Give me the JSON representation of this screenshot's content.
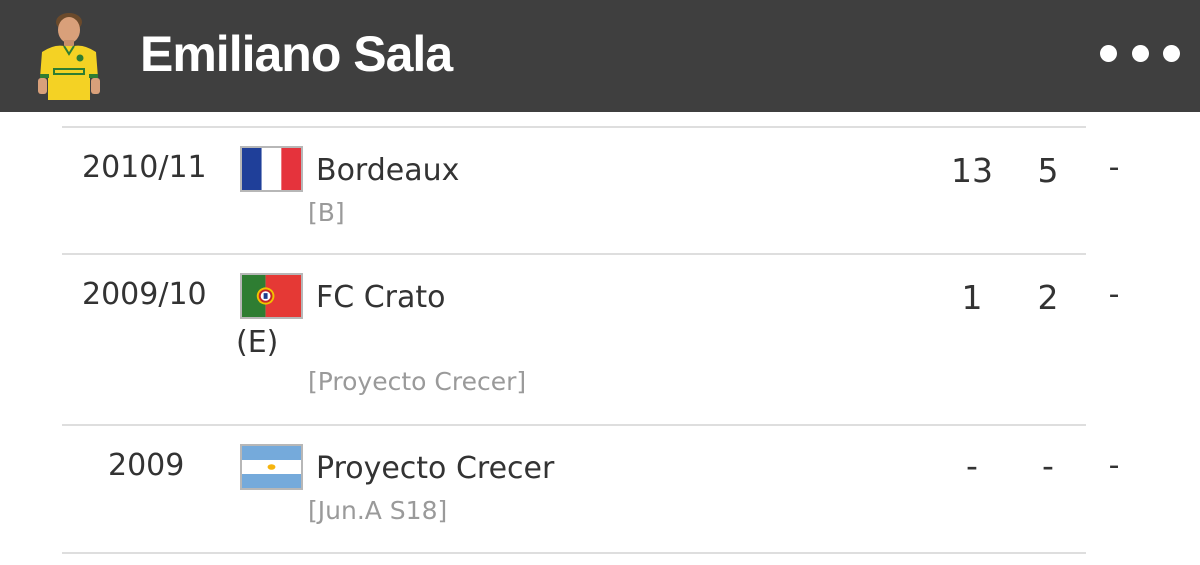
{
  "header": {
    "title": "Emiliano Sala",
    "avatar_icon": "player-photo",
    "menu_icon": "more-dots-icon",
    "background_color": "#3f3f3f"
  },
  "rows": [
    {
      "season": "2010/11",
      "flag": "france-flag",
      "club": "Bordeaux",
      "club_suffix": "",
      "note": "[B]",
      "apps": "13",
      "goals": "5",
      "extra": "-"
    },
    {
      "season": "2009/10",
      "flag": "portugal-flag",
      "club": "FC Crato",
      "club_suffix": "(E)",
      "note": "[Proyecto Crecer]",
      "apps": "1",
      "goals": "2",
      "extra": "-"
    },
    {
      "season": "2009",
      "flag": "argentina-flag",
      "club": "Proyecto Crecer",
      "club_suffix": "",
      "note": "[Jun.A S18]",
      "apps": "-",
      "goals": "-",
      "extra": "-"
    }
  ]
}
